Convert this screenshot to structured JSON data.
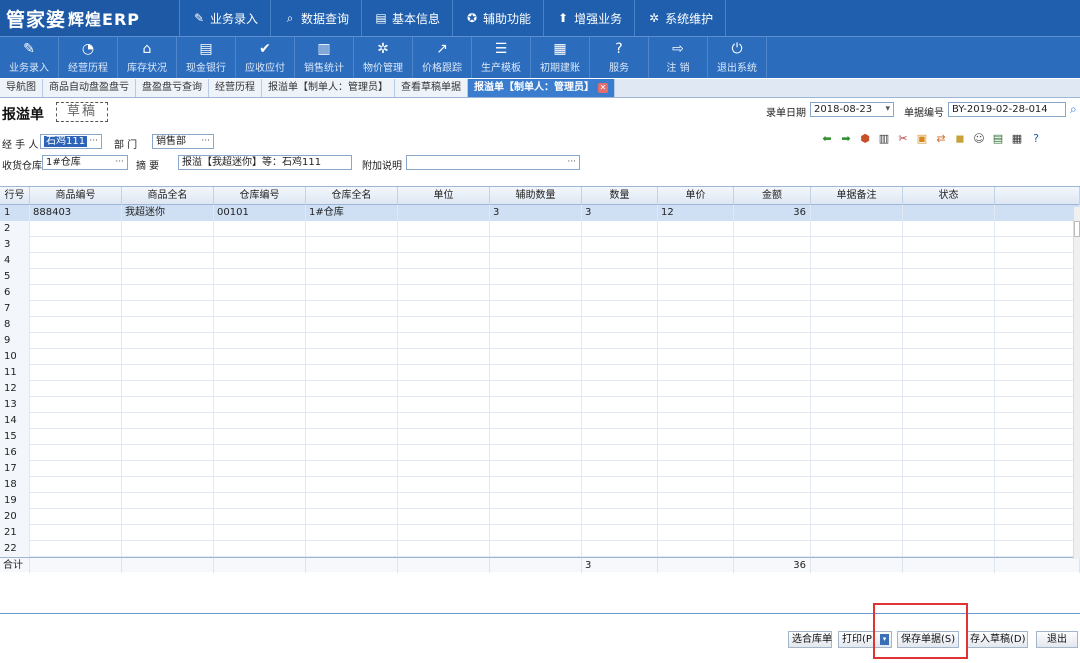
{
  "app": {
    "logo_main": "管家婆",
    "logo_sub": "辉煌ERP"
  },
  "top_menu": [
    {
      "label": "业务录入",
      "icon": "pencil-icon"
    },
    {
      "label": "数据查询",
      "icon": "search-icon"
    },
    {
      "label": "基本信息",
      "icon": "document-icon"
    },
    {
      "label": "辅助功能",
      "icon": "gear-circle-icon"
    },
    {
      "label": "增强业务",
      "icon": "arrow-up-icon"
    },
    {
      "label": "系统维护",
      "icon": "cog-icon"
    }
  ],
  "toolbar": [
    {
      "label": "业务录入",
      "glyph": "✎"
    },
    {
      "label": "经营历程",
      "glyph": "◔"
    },
    {
      "label": "库存状况",
      "glyph": "⌂"
    },
    {
      "label": "现金银行",
      "glyph": "▤"
    },
    {
      "label": "应收应付",
      "glyph": "✔"
    },
    {
      "label": "销售统计",
      "glyph": "▥"
    },
    {
      "label": "物价管理",
      "glyph": "✲"
    },
    {
      "label": "价格跟踪",
      "glyph": "↗"
    },
    {
      "label": "生产模板",
      "glyph": "☰"
    },
    {
      "label": "初期建账",
      "glyph": "▦"
    },
    {
      "label": "服务",
      "glyph": "?"
    },
    {
      "label": "注  销",
      "glyph": "⇨"
    },
    {
      "label": "退出系统",
      "glyph": "⏻"
    }
  ],
  "tabs": [
    {
      "label": "导航图"
    },
    {
      "label": "商品自动盘盈盘亏"
    },
    {
      "label": "盘盈盘亏查询"
    },
    {
      "label": "经营历程"
    },
    {
      "label": "报溢单【制单人：管理员】"
    },
    {
      "label": "查看草稿单据"
    },
    {
      "label": "报溢单【制单人：管理员】",
      "active": true
    }
  ],
  "form": {
    "title": "报溢单",
    "draft_stamp": "草稿",
    "date_label": "录单日期",
    "date_value": "2018-08-23",
    "docno_label": "单据编号",
    "docno_value": "BY-2019-02-28-014",
    "handler_label": "经 手 人",
    "handler_value": "石鸡111",
    "dept_label": "部    门",
    "dept_value": "销售部",
    "warehouse_label": "收货仓库",
    "warehouse_value": "1#仓库",
    "summary_label": "摘    要",
    "summary_value": "报溢【我超迷你】等：石鸡111",
    "note_label": "附加说明",
    "note_value": ""
  },
  "grid": {
    "columns": [
      "行号",
      "商品编号",
      "商品全名",
      "仓库编号",
      "仓库全名",
      "单位",
      "辅助数量",
      "数量",
      "单价",
      "金额",
      "单据备注",
      "状态",
      ""
    ],
    "rows": [
      {
        "no": "1",
        "code": "888403",
        "name": "我超迷你",
        "wh_code": "00101",
        "wh_name": "1#仓库",
        "unit": "",
        "aux": "3",
        "qty": "3",
        "price": "12",
        "amount": "36",
        "remark": "",
        "status": ""
      }
    ],
    "empty_rows": [
      "2",
      "3",
      "4",
      "5",
      "6",
      "7",
      "8",
      "9",
      "10",
      "11",
      "12",
      "13",
      "14",
      "15",
      "16",
      "17",
      "18",
      "19",
      "20",
      "21",
      "22"
    ],
    "footer": {
      "label": "合计",
      "qty": "3",
      "amount": "36"
    }
  },
  "buttons": {
    "select_warehouse": "选合库单",
    "print": "打印(P",
    "save": "保存单据(S)",
    "draft": "存入草稿(D)",
    "exit": "退出"
  }
}
